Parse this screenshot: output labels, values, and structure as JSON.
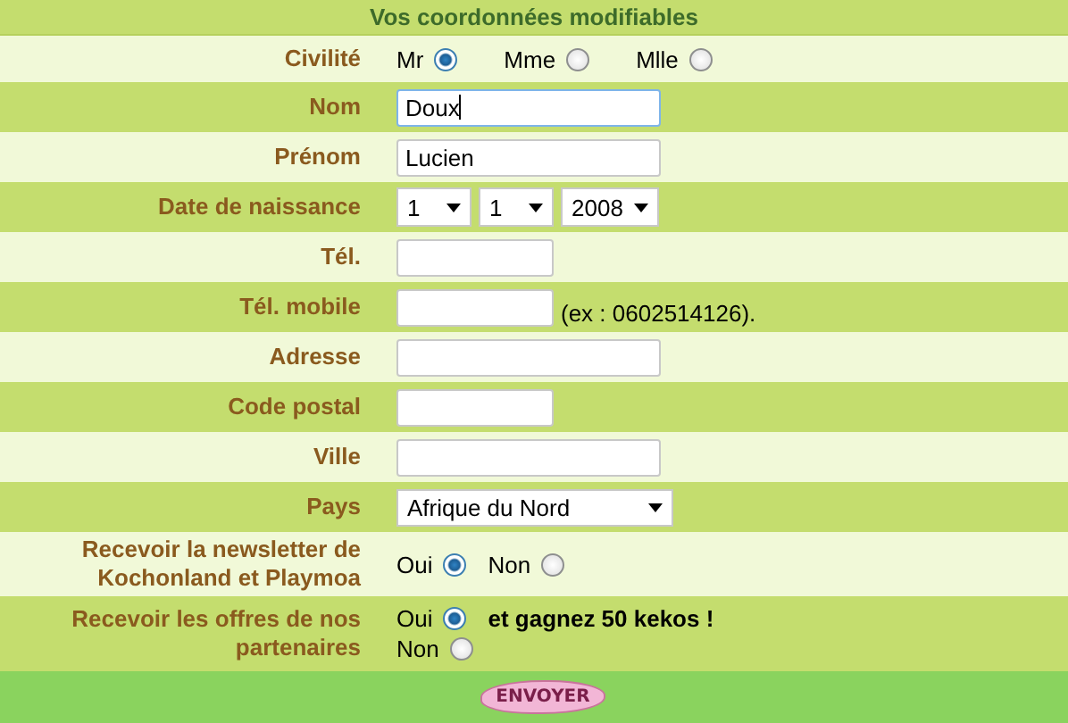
{
  "title": "Vos coordonnées modifiables",
  "rows": [
    {
      "kind": "radios",
      "label": "Civilité",
      "options": [
        {
          "label": "Mr",
          "selected": true
        },
        {
          "label": "Mme",
          "selected": false
        },
        {
          "label": "Mlle",
          "selected": false
        }
      ]
    },
    {
      "kind": "text",
      "label": "Nom",
      "value": "Doux",
      "wide": true,
      "focused": true
    },
    {
      "kind": "text",
      "label": "Prénom",
      "value": "Lucien",
      "wide": true,
      "focused": false
    },
    {
      "kind": "date",
      "label": "Date de naissance",
      "values": [
        "1",
        "1",
        "2008"
      ]
    },
    {
      "kind": "text",
      "label": "Tél.",
      "wide": false,
      "focused": false
    },
    {
      "kind": "text",
      "label": "Tél. mobile",
      "wide": false,
      "focused": false,
      "hint": "(ex : 0602514126)."
    },
    {
      "kind": "text",
      "label": "Adresse",
      "wide": true,
      "focused": false
    },
    {
      "kind": "text",
      "label": "Code postal",
      "wide": false,
      "focused": false
    },
    {
      "kind": "text",
      "label": "Ville",
      "wide": true,
      "focused": false
    },
    {
      "kind": "select",
      "label": "Pays",
      "value": "Afrique du Nord"
    },
    {
      "kind": "radios",
      "label": "Recevoir la newsletter de Kochonland et Playmoa",
      "options": [
        {
          "label": "Oui",
          "selected": true
        },
        {
          "label": "Non",
          "selected": false
        }
      ]
    },
    {
      "kind": "stacked",
      "label": "Recevoir les offres de nos partenaires",
      "options": [
        {
          "label": "Oui",
          "selected": true,
          "note": "et gagnez 50 kekos !"
        },
        {
          "label": "Non",
          "selected": false
        }
      ]
    }
  ],
  "submit": "ENVOYER"
}
